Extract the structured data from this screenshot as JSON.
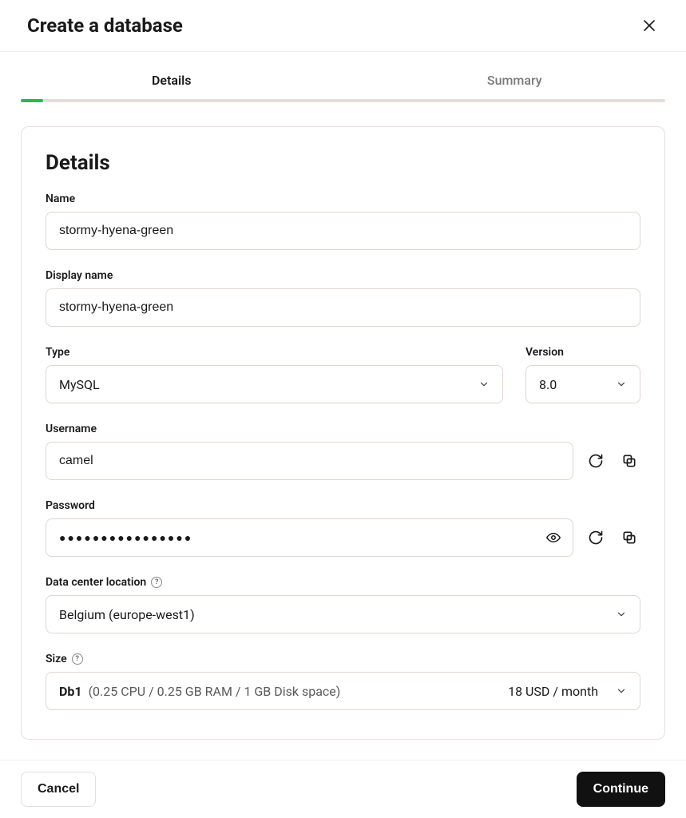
{
  "header": {
    "title": "Create a database"
  },
  "tabs": {
    "details": "Details",
    "summary": "Summary"
  },
  "section": {
    "title": "Details"
  },
  "fields": {
    "name": {
      "label": "Name",
      "value": "stormy-hyena-green"
    },
    "display_name": {
      "label": "Display name",
      "value": "stormy-hyena-green"
    },
    "type": {
      "label": "Type",
      "value": "MySQL"
    },
    "version": {
      "label": "Version",
      "value": "8.0"
    },
    "username": {
      "label": "Username",
      "value": "camel"
    },
    "password": {
      "label": "Password",
      "masked": "●●●●●●●●●●●●●●●●"
    },
    "location": {
      "label": "Data center location",
      "value": "Belgium (europe-west1)"
    },
    "size": {
      "label": "Size",
      "name": "Db1",
      "specs": "(0.25 CPU / 0.25 GB RAM / 1 GB Disk space)",
      "price": "18 USD / month"
    }
  },
  "footer": {
    "cancel": "Cancel",
    "continue": "Continue"
  }
}
